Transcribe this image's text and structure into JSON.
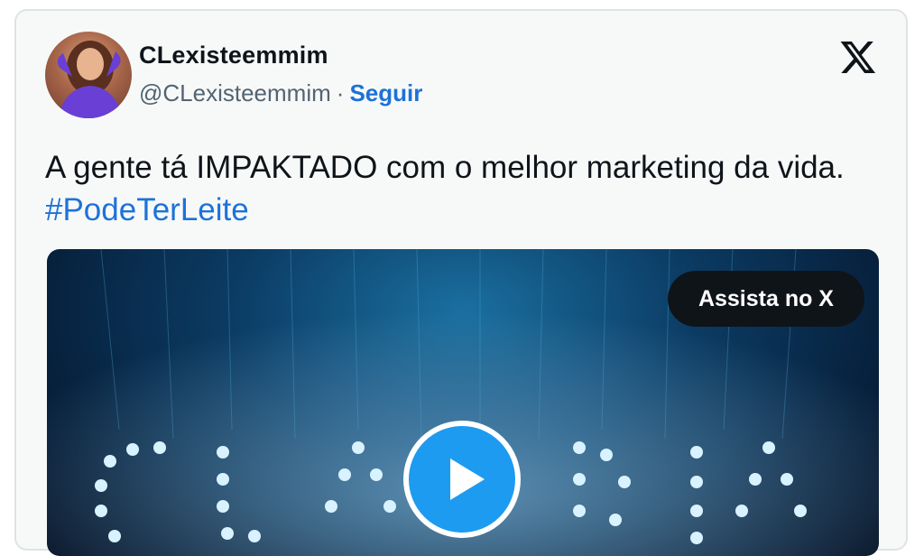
{
  "tweet": {
    "user_name": "CLexisteemmim",
    "handle": "@CLexisteemmim",
    "separator": "·",
    "follow_label": "Seguir",
    "text_main": "A gente tá IMPAKTADO com o melhor marketing da vida.",
    "hashtag": "#PodeTerLeite",
    "icons": {
      "logo": "x-logo-icon",
      "avatar": "avatar-image",
      "play": "play-icon"
    }
  },
  "media": {
    "watch_label": "Assista no X"
  },
  "colors": {
    "link": "#1d72d8",
    "text": "#0f1419",
    "muted": "#536471",
    "card_bg": "#f7f9f9",
    "play": "#1d9bf0"
  }
}
